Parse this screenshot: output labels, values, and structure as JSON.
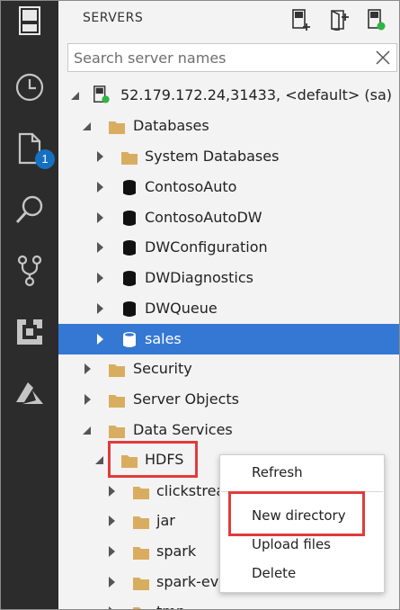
{
  "activity_bar": {
    "items": [
      {
        "name": "servers-icon"
      },
      {
        "name": "history-icon"
      },
      {
        "name": "file-icon",
        "badge": "1"
      },
      {
        "name": "search-icon"
      },
      {
        "name": "source-control-icon"
      },
      {
        "name": "extensions-icon"
      },
      {
        "name": "azure-icon"
      }
    ],
    "colors": {
      "background": "#2c2c2c",
      "icon": "#c5c5c5",
      "badge": "#1570c0"
    }
  },
  "servers_panel": {
    "title": "SERVERS",
    "actions": [
      "new-connection-icon",
      "new-server-group-icon",
      "active-connections-icon"
    ],
    "search_placeholder": "Search server names",
    "search_value": ""
  },
  "tree": {
    "server": {
      "label": "52.179.172.24,31433, <default> (sa)",
      "status_color": "#2fb543"
    },
    "databases_folder": {
      "label": "Databases"
    },
    "databases": [
      {
        "label": "System Databases",
        "type": "folder"
      },
      {
        "label": "ContosoAuto",
        "type": "database"
      },
      {
        "label": "ContosoAutoDW",
        "type": "database"
      },
      {
        "label": "DWConfiguration",
        "type": "database"
      },
      {
        "label": "DWDiagnostics",
        "type": "database"
      },
      {
        "label": "DWQueue",
        "type": "database"
      },
      {
        "label": "sales",
        "type": "database",
        "selected": true
      }
    ],
    "folders": [
      {
        "label": "Security"
      },
      {
        "label": "Server Objects"
      },
      {
        "label": "Data Services"
      }
    ],
    "hdfs": {
      "label": "HDFS"
    },
    "hdfs_children": [
      {
        "label": "clickstrea"
      },
      {
        "label": "jar"
      },
      {
        "label": "spark"
      },
      {
        "label": "spark-eve"
      },
      {
        "label": "tmp"
      }
    ],
    "colors": {
      "selection": "#3478d4",
      "folder": "#d9ad5f",
      "highlight_box": "#e23a3a"
    }
  },
  "context_menu": {
    "items": [
      {
        "label": "Refresh"
      },
      {
        "label": "New directory",
        "highlighted": true
      },
      {
        "label": "Upload files"
      },
      {
        "label": "Delete"
      }
    ]
  }
}
